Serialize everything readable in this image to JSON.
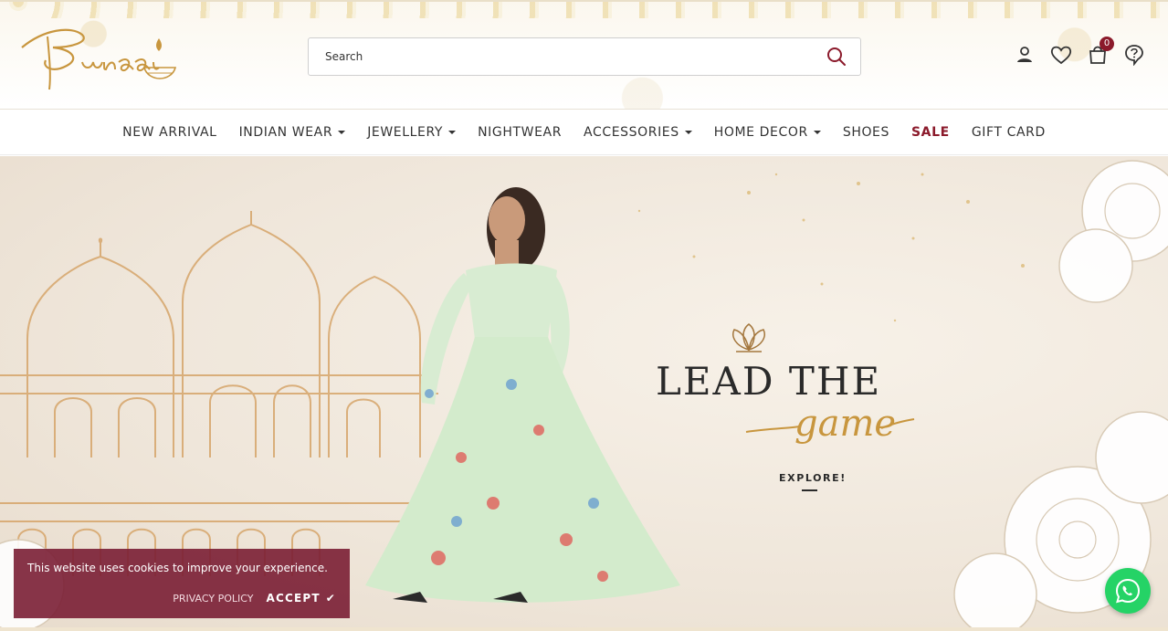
{
  "brand": {
    "name": "Bunaai",
    "accent": "#8b1a2b",
    "gold": "#c8963e"
  },
  "search": {
    "placeholder": "Search"
  },
  "header_icons": [
    "account-icon",
    "heart-icon",
    "shopping-bag-icon",
    "help-icon"
  ],
  "cart": {
    "count": "0"
  },
  "nav": {
    "items": [
      {
        "label": "NEW ARRIVAL",
        "dropdown": false
      },
      {
        "label": "INDIAN WEAR",
        "dropdown": true
      },
      {
        "label": "JEWELLERY",
        "dropdown": true
      },
      {
        "label": "NIGHTWEAR",
        "dropdown": false
      },
      {
        "label": "ACCESSORIES",
        "dropdown": true
      },
      {
        "label": "HOME DECOR",
        "dropdown": true
      },
      {
        "label": "SHOES",
        "dropdown": false
      },
      {
        "label": "SALE",
        "dropdown": false,
        "highlight": true
      },
      {
        "label": "GIFT CARD",
        "dropdown": false
      }
    ]
  },
  "hero": {
    "title": "LEAD THE",
    "script": "game",
    "cta": "EXPLORE!"
  },
  "cookie": {
    "text": "This website uses cookies to improve your experience.",
    "privacy_label": "PRIVACY POLICY",
    "accept_label": "ACCEPT"
  },
  "whatsapp": {
    "color": "#25d366"
  }
}
